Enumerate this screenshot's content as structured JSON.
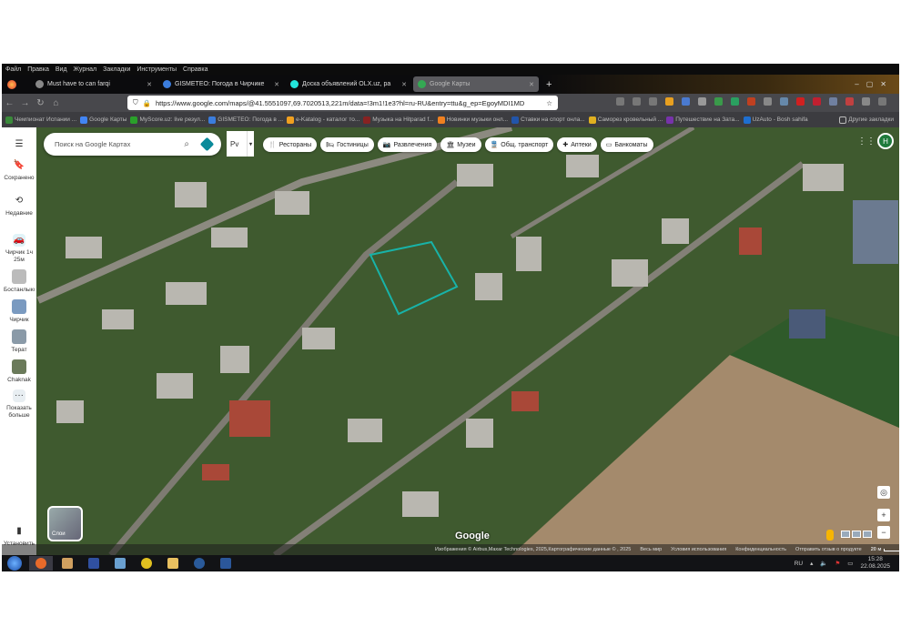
{
  "menu": [
    "Файл",
    "Правка",
    "Вид",
    "Журнал",
    "Закладки",
    "Инструменты",
    "Справка"
  ],
  "tabs": [
    {
      "label": "Must have to can farqi",
      "color": "#888"
    },
    {
      "label": "GISMETEO: Погода в Чирчике",
      "color": "#3b7ddd"
    },
    {
      "label": "Доска объявлений OLX.uz, ра",
      "color": "#23e5db"
    },
    {
      "label": "Google Карты",
      "color": "#34a853",
      "active": true
    }
  ],
  "url": "https://www.google.com/maps/@41.5551097,69.7020513,221m/data=!3m1!1e3?hl=ru-RU&entry=ttu&g_ep=EgoyMDI1MD",
  "bookmarks": [
    {
      "label": "Чемпионат Испании ...",
      "color": "#3a8a3a"
    },
    {
      "label": "Google Карты",
      "color": "#4285f4"
    },
    {
      "label": "MyScore.uz: live резул...",
      "color": "#2aa02a"
    },
    {
      "label": "GISMETEO: Погода в ...",
      "color": "#3b7ddd"
    },
    {
      "label": "e-Katalog - каталог то...",
      "color": "#f0a020"
    },
    {
      "label": "Музыка на Hitparad f...",
      "color": "#882222"
    },
    {
      "label": "Новинки музыки онл...",
      "color": "#f08020"
    },
    {
      "label": "Ставки на спорт онла...",
      "color": "#2255aa"
    },
    {
      "label": "Саморез кровельный ...",
      "color": "#e0b020"
    },
    {
      "label": "Путешествие на Зата...",
      "color": "#7733aa"
    },
    {
      "label": "UzAuto - Bosh sahifa",
      "color": "#1e6fd0"
    }
  ],
  "other_bookmarks": "Другие закладки",
  "map": {
    "search_placeholder": "Поиск на Google Картах",
    "lang": "Рv",
    "chips": [
      {
        "icon": "🍴",
        "label": "Рестораны"
      },
      {
        "icon": "🛏",
        "label": "Гостиницы"
      },
      {
        "icon": "📷",
        "label": "Развлечения"
      },
      {
        "icon": "🏛",
        "label": "Музеи"
      },
      {
        "icon": "🚆",
        "label": "Общ. транспорт"
      },
      {
        "icon": "✚",
        "label": "Аптеки"
      },
      {
        "icon": "▭",
        "label": "Банкоматы"
      }
    ],
    "sidebar": {
      "saved": "Сохранено",
      "recent": "Недавние",
      "commute": "Чирчик 1ч 25м",
      "recents": [
        "Бостанлыкский...",
        "Чирчик",
        "Терат",
        "Chaknak"
      ],
      "more": "Показать больше",
      "install": "Установить"
    },
    "avatar": "Н",
    "layers": "Слои",
    "logo": "Google",
    "attribution": "Изображения © Airbus,Maxar Technologies, 2025,Картографические данные © , 2025",
    "links": [
      "Весь мир",
      "Условия использования",
      "Конфиденциальность",
      "Отправить отзыв о продукте"
    ],
    "scale": "20 м"
  },
  "tray": {
    "lang": "RU",
    "time": "15:28",
    "date": "22.08.2025"
  }
}
